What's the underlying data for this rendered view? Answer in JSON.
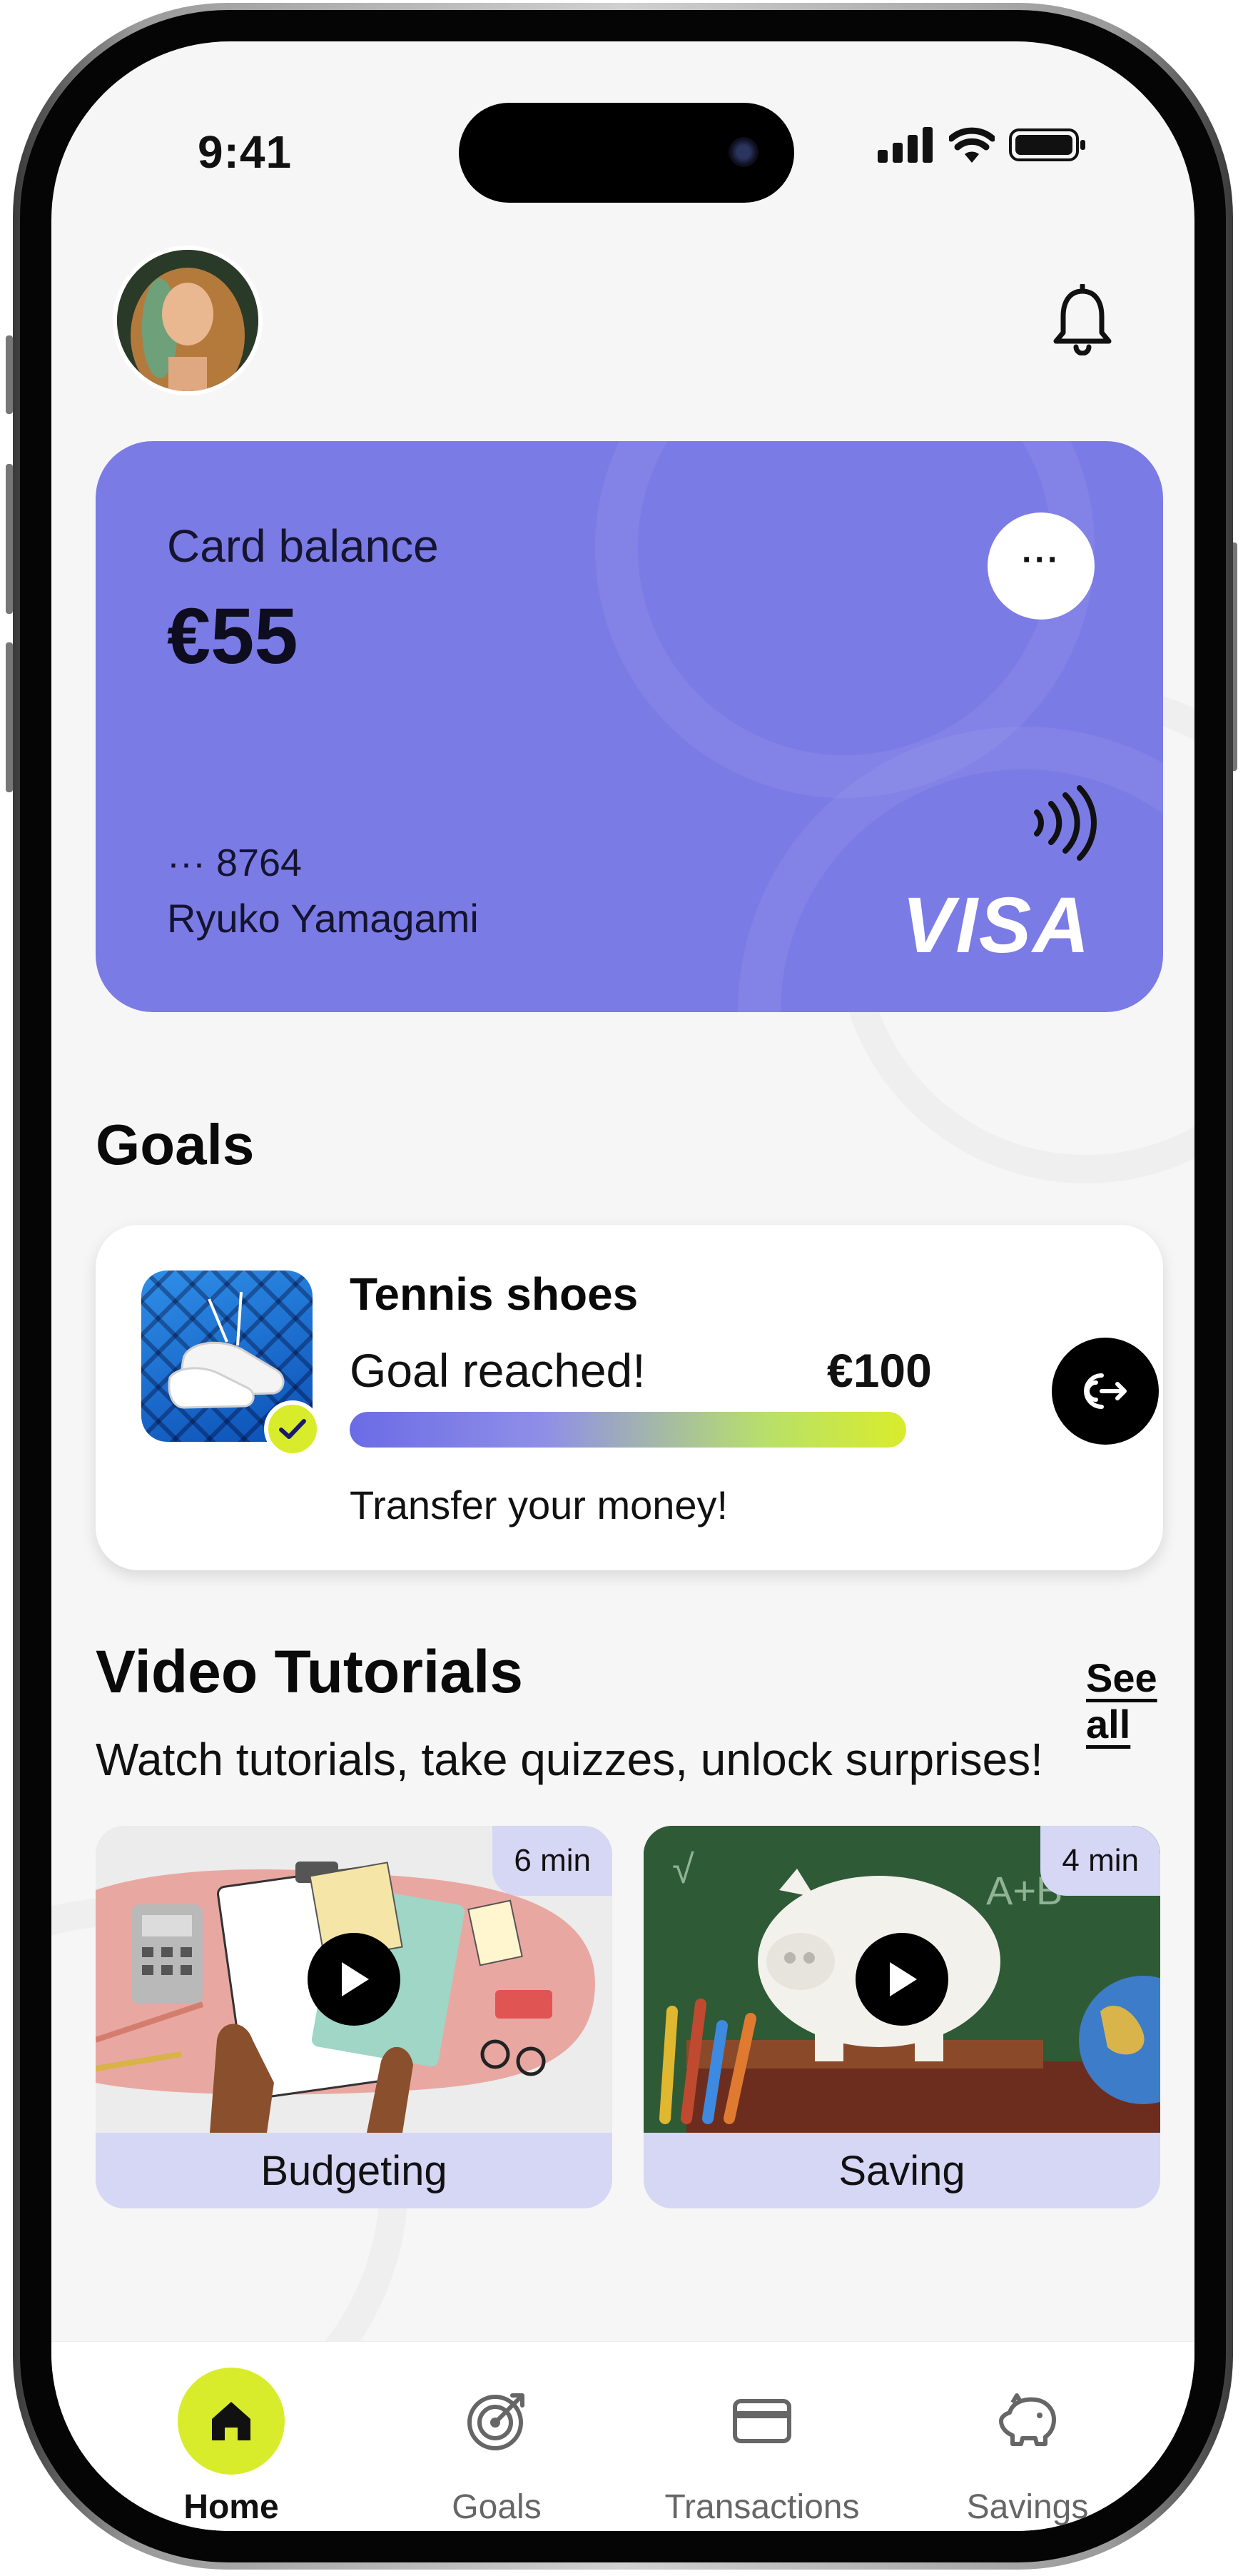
{
  "status_bar": {
    "time": "9:41",
    "icons": [
      "signal-icon",
      "wifi-icon",
      "battery-icon"
    ]
  },
  "header": {
    "avatar": "avatar",
    "notification_icon": "bell-icon"
  },
  "card": {
    "label": "Card balance",
    "balance": "€55",
    "menu_label": "···",
    "number": "··· 8764",
    "holder": "Ryuko Yamagami",
    "brand": "VISA",
    "contactless_icon": "nfc-icon",
    "color": "#7b7be6"
  },
  "goals": {
    "title": "Goals",
    "items": [
      {
        "name": "Tennis shoes",
        "status": "Goal reached!",
        "amount": "€100",
        "progress": 1.0,
        "action_text": "Transfer your money!",
        "action_icon": "transfer-icon"
      }
    ]
  },
  "tutorials": {
    "title": "Video Tutorials",
    "see_all": "See all",
    "subtitle": "Watch tutorials, take quizzes, unlock surprises!",
    "videos": [
      {
        "label": "Budgeting",
        "duration": "6 min"
      },
      {
        "label": "Saving",
        "duration": "4 min"
      }
    ]
  },
  "nav": {
    "items": [
      {
        "label": "Home",
        "icon": "home-icon",
        "active": true
      },
      {
        "label": "Goals",
        "icon": "target-icon",
        "active": false
      },
      {
        "label": "Transactions",
        "icon": "card-icon",
        "active": false
      },
      {
        "label": "Savings",
        "icon": "piggy-bank-icon",
        "active": false
      }
    ]
  },
  "colors": {
    "accent": "#d9ec2b",
    "card": "#7b7be6",
    "tutorial_label_bg": "#d6d6f5"
  }
}
